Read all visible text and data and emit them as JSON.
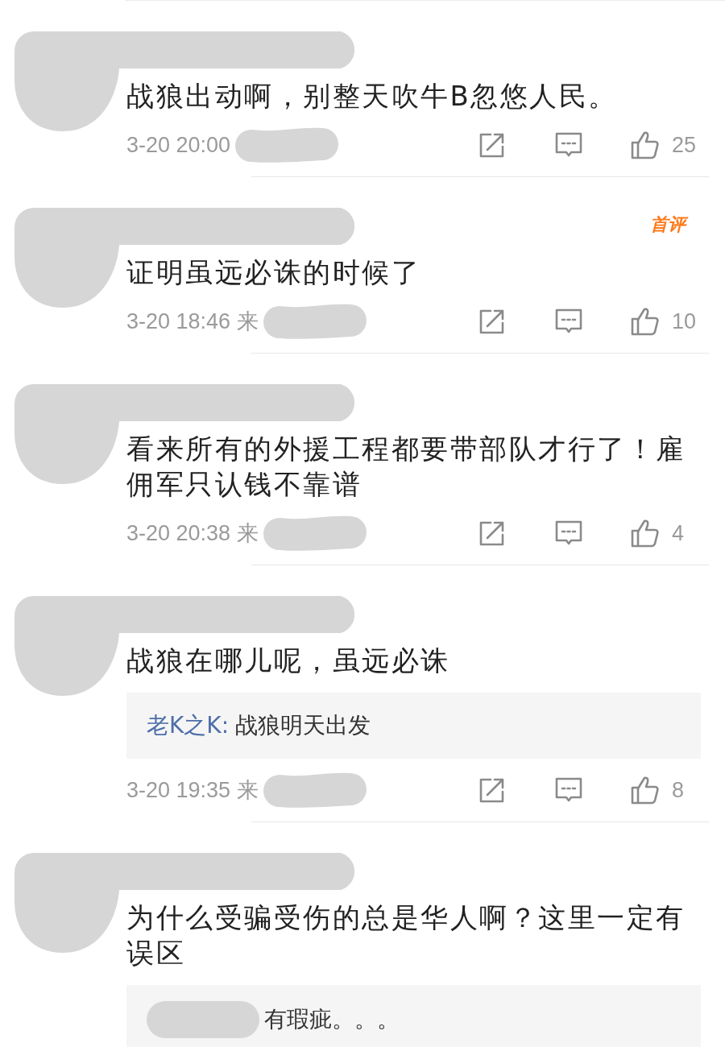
{
  "comments": [
    {
      "text": "战狼出动啊，别整天吹牛B忽悠人民。",
      "time": "3-20 20:00",
      "likes": "25"
    },
    {
      "badge": "首评",
      "text": "证明虽远必诛的时候了",
      "time": "3-20 18:46 来",
      "likes": "10"
    },
    {
      "text": "看来所有的外援工程都要带部队才行了！雇佣军只认钱不靠谱",
      "time": "3-20 20:38 来",
      "likes": "4"
    },
    {
      "text": "战狼在哪儿呢，虽远必诛",
      "reply": {
        "author": "老K之K:",
        "text": "战狼明天出发"
      },
      "time": "3-20 19:35 来",
      "likes": "8"
    },
    {
      "text": "为什么受骗受伤的总是华人啊？这里一定有误区",
      "reply": {
        "text": "有瑕疵。。。"
      }
    }
  ]
}
